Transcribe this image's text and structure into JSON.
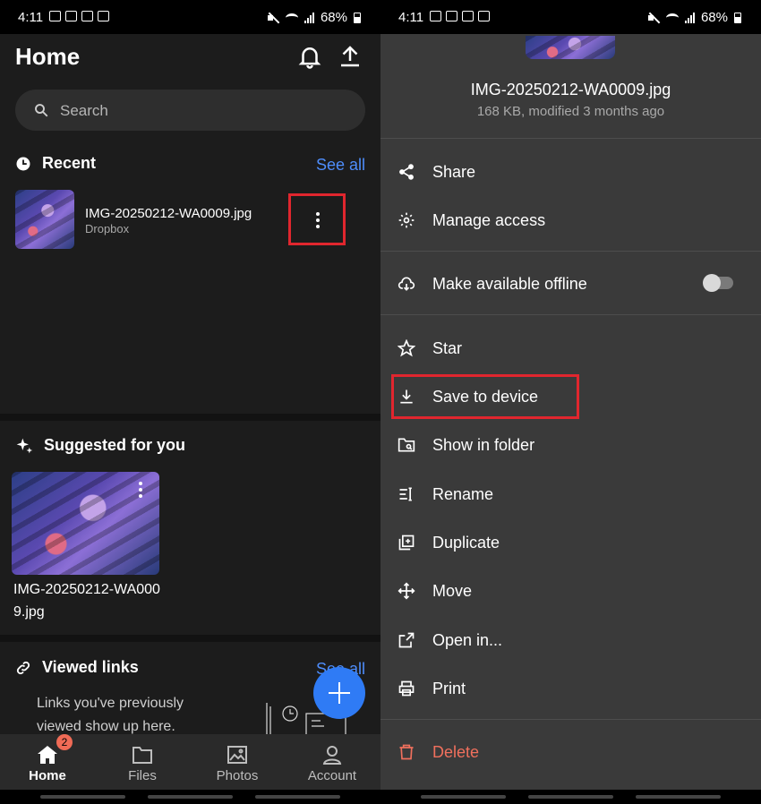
{
  "status": {
    "time": "4:11",
    "battery": "68%"
  },
  "left": {
    "title": "Home",
    "search": {
      "placeholder": "Search"
    },
    "recent": {
      "heading": "Recent",
      "see_all": "See all",
      "file_name": "IMG-20250212-WA0009.jpg",
      "file_location": "Dropbox"
    },
    "suggested": {
      "heading": "Suggested for you",
      "file_name": "IMG-20250212-WA0009.jpg"
    },
    "viewed_links": {
      "heading": "Viewed links",
      "see_all": "See all",
      "empty_text": "Links you've previously viewed show up here."
    },
    "nav": [
      {
        "label": "Home",
        "badge": "2",
        "icon": "home-icon"
      },
      {
        "label": "Files",
        "icon": "folder-icon"
      },
      {
        "label": "Photos",
        "icon": "photo-icon"
      },
      {
        "label": "Account",
        "icon": "person-icon"
      }
    ]
  },
  "right": {
    "file_name": "IMG-20250212-WA0009.jpg",
    "file_meta": "168 KB, modified 3 months ago",
    "menu": {
      "share": "Share",
      "manage_access": "Manage access",
      "offline": "Make available offline",
      "star": "Star",
      "save": "Save to device",
      "show_folder": "Show in folder",
      "rename": "Rename",
      "duplicate": "Duplicate",
      "move": "Move",
      "open_in": "Open in...",
      "print": "Print",
      "delete": "Delete"
    }
  },
  "colors": {
    "accent": "#4e8dfb",
    "fab": "#2f7bf5",
    "highlight": "#e0262e",
    "danger": "#f0705d"
  }
}
